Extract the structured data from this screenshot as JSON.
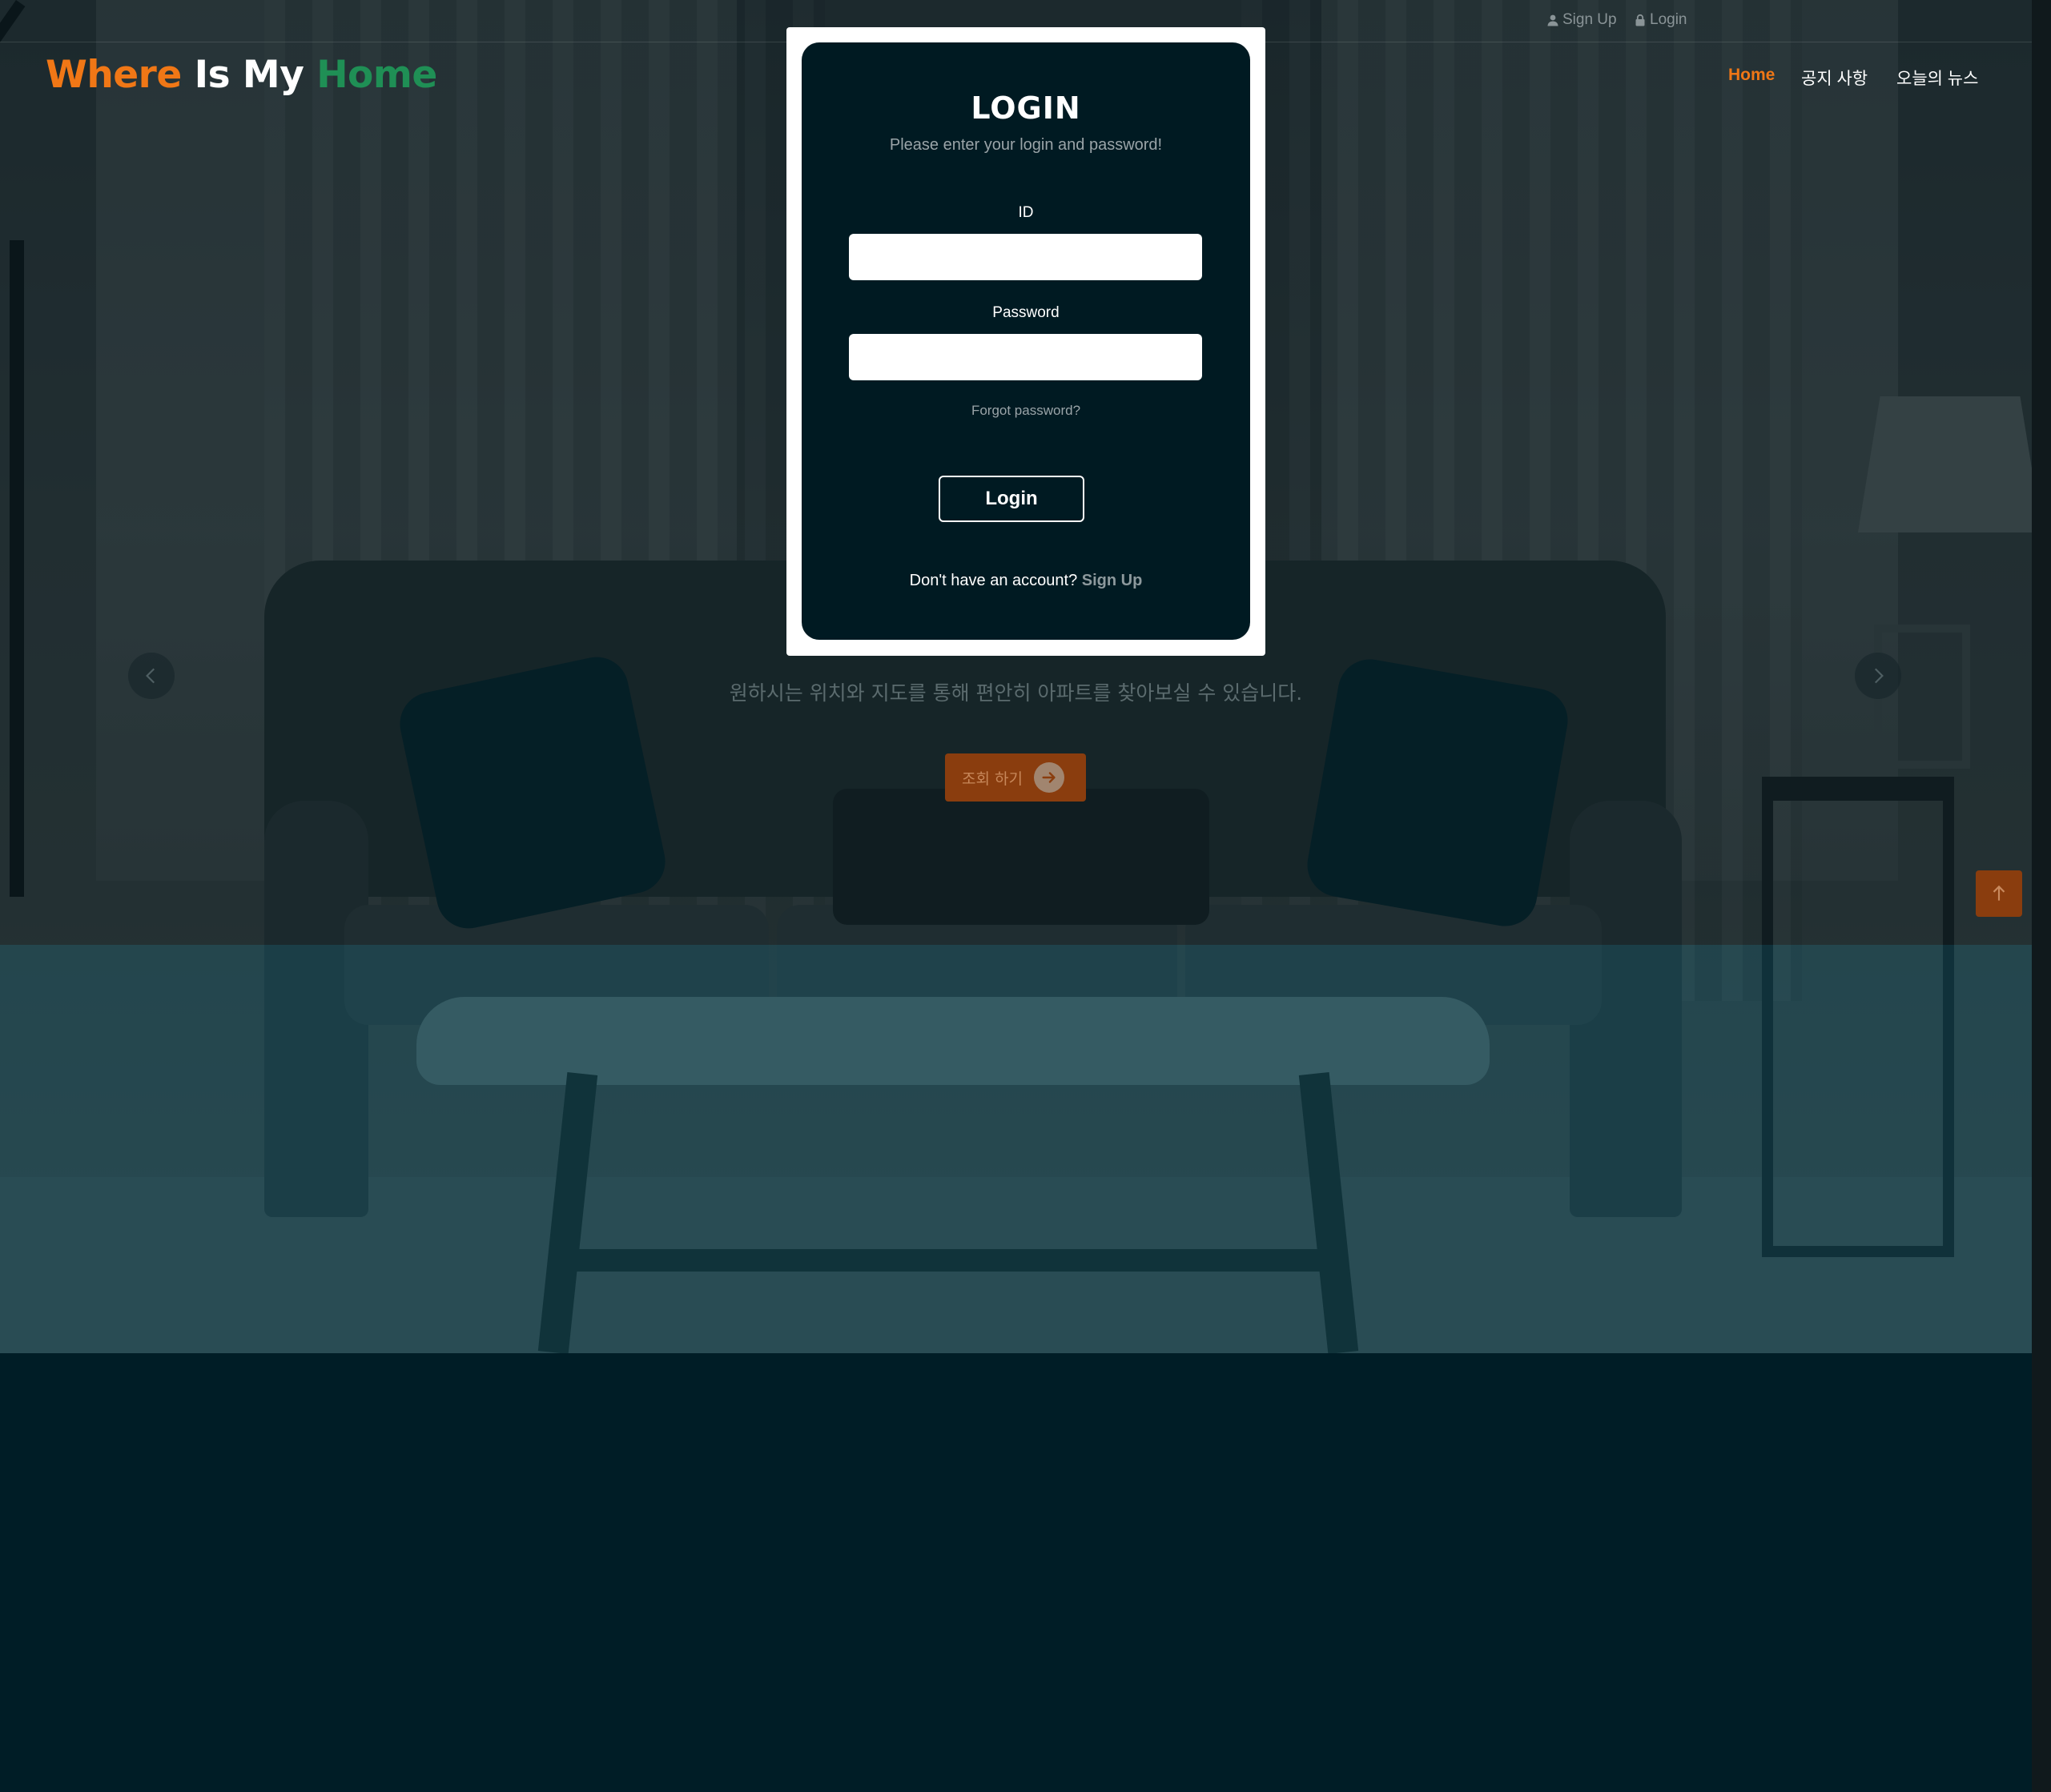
{
  "topbar": {
    "signup_label": "Sign Up",
    "login_label": "Login"
  },
  "header": {
    "logo": {
      "word1": "Where",
      "word2": "Is My",
      "word3": "Home"
    },
    "nav": [
      {
        "label": "Home",
        "active": true
      },
      {
        "label": "공지 사항",
        "active": false
      },
      {
        "label": "오늘의 뉴스",
        "active": false
      }
    ]
  },
  "hero": {
    "subtitle": "원하시는 위치와 지도를 통해 편안히 아파트를 찾아보실 수 있습니다.",
    "cta_label": "조회 하기"
  },
  "login_modal": {
    "title": "LOGIN",
    "subtitle": "Please enter your login and password!",
    "id_label": "ID",
    "id_value": "",
    "password_label": "Password",
    "password_value": "",
    "forgot_label": "Forgot password?",
    "submit_label": "Login",
    "no_account_text": "Don't have an account?",
    "signup_link": "Sign Up"
  },
  "icons": {
    "signup": "user-icon",
    "login": "lock-icon",
    "cta": "arrow-right-circle-icon",
    "carousel_prev": "chevron-left-icon",
    "carousel_next": "chevron-right-icon",
    "scroll_top": "arrow-up-icon"
  },
  "colors": {
    "brand_orange": "#f07716",
    "brand_green": "#1f8f55",
    "modal_bg": "#001a22",
    "page_bg": "#001d26"
  }
}
